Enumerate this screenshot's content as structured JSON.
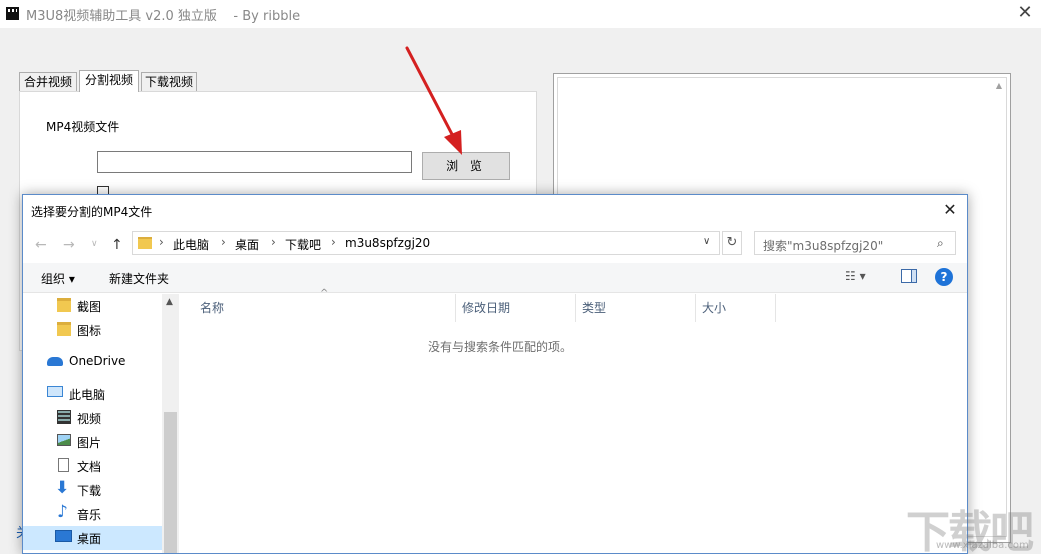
{
  "app": {
    "title": "M3U8视频辅助工具 v2.0 独立版    - By ribble",
    "close_glyph": "✕",
    "tabs": [
      {
        "label": "合并视频"
      },
      {
        "label": "分割视频"
      },
      {
        "label": "下载视频"
      }
    ],
    "mp4_label": "MP4视频文件",
    "mp4_path_value": "",
    "browse_label": "浏 览",
    "left_edge_text": "关"
  },
  "dialog": {
    "title": "选择要分割的MP4文件",
    "close_glyph": "✕",
    "nav_back": "←",
    "nav_forward": "→",
    "nav_recent": "∨",
    "nav_up": "↑",
    "breadcrumbs": [
      "此电脑",
      "桌面",
      "下载吧",
      "m3u8spfzgj20"
    ],
    "breadcrumb_sep": "›",
    "address_dropdown": "∨",
    "refresh_glyph": "↻",
    "search_placeholder": "搜索\"m3u8spfzgj20\"",
    "search_icon": "⌕",
    "toolbar": {
      "organize_label": "组织 ▾",
      "new_folder_label": "新建文件夹",
      "view_label": "☷ ▾",
      "help_label": "?"
    },
    "nav_items": [
      {
        "label": "截图",
        "icon": "folder-icon"
      },
      {
        "label": "图标",
        "icon": "folder-icon"
      },
      {
        "label": "OneDrive",
        "icon": "cloud-icon"
      },
      {
        "label": "此电脑",
        "icon": "computer-icon"
      },
      {
        "label": "视频",
        "icon": "video-icon"
      },
      {
        "label": "图片",
        "icon": "picture-icon"
      },
      {
        "label": "文档",
        "icon": "document-icon"
      },
      {
        "label": "下载",
        "icon": "download-icon"
      },
      {
        "label": "音乐",
        "icon": "music-icon"
      },
      {
        "label": "桌面",
        "icon": "desktop-icon",
        "selected": true
      }
    ],
    "nav_scroll_up": "▲",
    "columns": [
      "名称",
      "修改日期",
      "类型",
      "大小"
    ],
    "sort_caret": "^",
    "empty_message": "没有与搜索条件匹配的项。"
  },
  "colors": {
    "accent": "#1e73d8",
    "selection": "#cce8ff",
    "arrow": "#d42020",
    "folder": "#f1c850"
  },
  "watermark": {
    "text": "下载吧",
    "url": "www.xiazaiba.com"
  }
}
